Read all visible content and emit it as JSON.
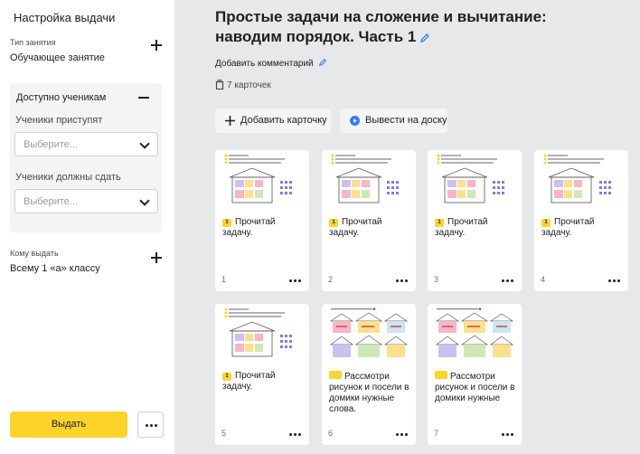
{
  "sidebar": {
    "title": "Настройка выдачи",
    "lesson_type": {
      "label": "Тип занятия",
      "value": "Обучающее занятие"
    },
    "available": {
      "title": "Доступно ученикам",
      "start_label": "Ученики приступят",
      "start_placeholder": "Выберите...",
      "due_label": "Ученики должны сдать",
      "due_placeholder": "Выберите..."
    },
    "assign_to": {
      "label": "Кому выдать",
      "value": "Всему 1 «а» классу"
    },
    "issue_button": "Выдать"
  },
  "main": {
    "title": "Простые задачи на сложение и вычитание: наводим порядок. Часть 1",
    "add_comment": "Добавить комментарий",
    "card_count": "7 карточек",
    "add_card_button": "Добавить карточку",
    "show_on_board_button": "Вывести на доску"
  },
  "cards": [
    {
      "number": "1",
      "badge": "1",
      "text": "Прочитай задачу.",
      "kind": "house"
    },
    {
      "number": "2",
      "badge": "1",
      "text": "Прочитай задачу.",
      "kind": "house"
    },
    {
      "number": "3",
      "badge": "1",
      "text": "Прочитай задачу.",
      "kind": "house"
    },
    {
      "number": "4",
      "badge": "1",
      "text": "Прочитай задачу.",
      "kind": "house"
    },
    {
      "number": "5",
      "badge": "1",
      "text": "Прочитай задачу.",
      "kind": "house"
    },
    {
      "number": "6",
      "badge": "",
      "text": "Рассмотри рисунок и посели в домики нужные слова.",
      "kind": "houses"
    },
    {
      "number": "7",
      "badge": "",
      "text": "Рассмотри рисунок и посели в домики нужные",
      "kind": "houses"
    }
  ],
  "colors": {
    "accent": "#fed42b",
    "play_icon": "#3a7bfa",
    "edit_icon": "#3a7bfa"
  }
}
